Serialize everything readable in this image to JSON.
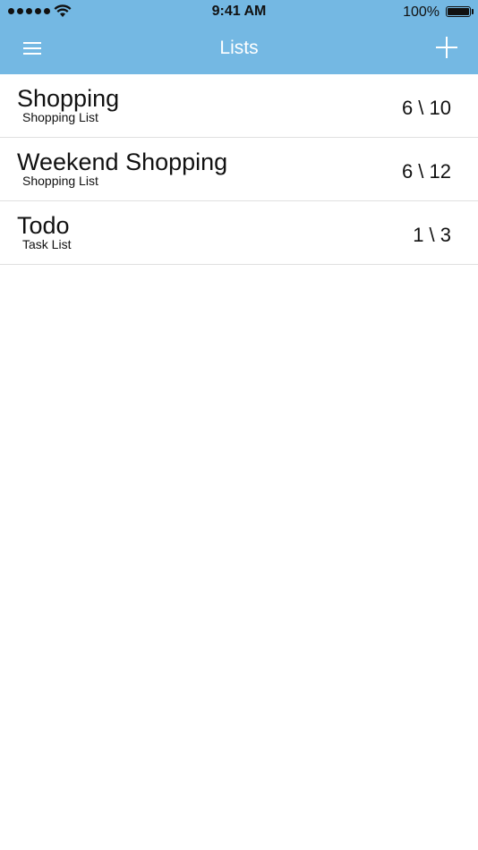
{
  "status_bar": {
    "time": "9:41 AM",
    "battery_percent": "100%",
    "battery_level": 1.0,
    "signal_bars": 5
  },
  "nav": {
    "title": "Lists",
    "menu_icon": "hamburger-menu-icon",
    "add_icon": "plus-icon",
    "background_color": "#74b8e3"
  },
  "lists": [
    {
      "title": "Shopping",
      "subtitle": "Shopping List",
      "count": "6 \\ 10"
    },
    {
      "title": "Weekend Shopping",
      "subtitle": "Shopping List",
      "count": "6 \\ 12"
    },
    {
      "title": "Todo",
      "subtitle": "Task List",
      "count": "1 \\ 3"
    }
  ]
}
